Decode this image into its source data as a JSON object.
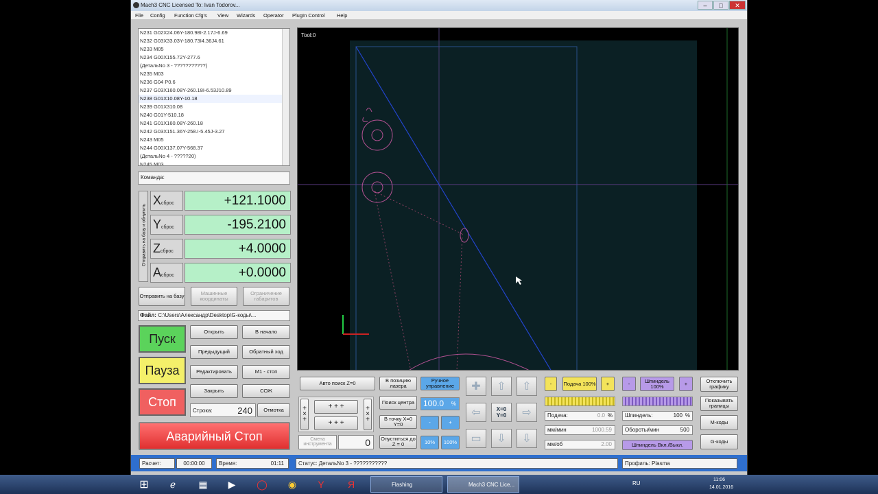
{
  "window": {
    "title": "Mach3 CNC  Licensed To: Ivan Todorov..."
  },
  "menu": [
    "File",
    "Config",
    "Function Cfg's",
    "View",
    "Wizards",
    "Operator",
    "PlugIn Control",
    "Help"
  ],
  "gcode_lines": [
    "N231 G02X24.06Y-180.98I-2.17J-6.69",
    "N232 G03X33.03Y-180.73I4.36J4.61",
    "N233 M05",
    "N234 G00X155.72Y-277.6",
    "(ДетальNo 3 - ???????????)",
    "N235 M03",
    "N236 G04 P0.6",
    "N237 G03X160.08Y-260.18I-6.53J10.89",
    "N238 G01X10.08Y-10.18",
    "N239 G01X310.08",
    "N240 G01Y-510.18",
    "N241 G01X160.08Y-260.18",
    "N242 G03X151.36Y-258.I-5.45J-3.27",
    "N243 M05",
    "N244 G00X137.07Y-568.37",
    "(ДетальNo 4 - ?????20)",
    "N245 M03"
  ],
  "selected_line": 8,
  "command_label": "Команда:",
  "dro": {
    "vertical_label": "Отправить на базу и обнулить",
    "axes": [
      {
        "letter": "X",
        "reset": "сброс",
        "value": "+121.1000"
      },
      {
        "letter": "Y",
        "reset": "сброс",
        "value": "-195.2100"
      },
      {
        "letter": "Z",
        "reset": "сброс",
        "value": "+4.0000"
      },
      {
        "letter": "A",
        "reset": "сброс",
        "value": "+0.0000"
      }
    ]
  },
  "buttons": {
    "ref_all": "Отправить на базу",
    "machine_coords": "Машинные координаты",
    "soft_limits": "Ограничение габаритов",
    "file_label": "Файл:",
    "file_path": "C:\\Users\\Александр\\Desktop\\G-коды\\..."
  },
  "run": {
    "start": "Пуск",
    "pause": "Пауза",
    "stop": "Стоп",
    "estop": "Аварийный Стоп",
    "open": "Открыть",
    "to_start": "В начало",
    "previous": "Предыдущий",
    "reverse": "Обратный ход",
    "edit": "Редактировать",
    "m1_stop": "M1 - стоп",
    "close": "Закрыть",
    "coolant": "СОЖ",
    "line_label": "Строка:",
    "line_value": "240",
    "rewind": "Отмотка"
  },
  "viewport": {
    "tool_label": "Tool:0"
  },
  "jog": {
    "auto_z": "Авто поиск Z=0",
    "laser_pos": "В позицию лазера",
    "manual": "Ручное управление",
    "find_center": "Поиск центра",
    "jog_pct": "100.0",
    "pct": "%",
    "goto_xy0": "В точку X=0 Y=0",
    "lower_z0": "Опуститься до Z = 0",
    "tool_change": "Смена инструмента",
    "tool_value": "0",
    "btn10": "10%",
    "btn100": "100%",
    "minus": "-",
    "plus": "+",
    "x0y0": "X=0 Y=0"
  },
  "feed": {
    "minus": "-",
    "plus": "+",
    "feed100": "Подача 100%",
    "feed_label": "Подача:",
    "feed_val": "0.0",
    "pct": "%",
    "mm_min_label": "мм/мин",
    "mm_min_val": "1000.59",
    "mm_rev_label": "мм/об",
    "mm_rev_val": "2.00"
  },
  "spindle": {
    "minus": "-",
    "plus": "+",
    "s100": "Шпиндель 100%",
    "label": "Шпиндель:",
    "pct_val": "100",
    "pct": "%",
    "rpm_label": "Обороты/мин",
    "rpm_val": "500",
    "toggle": "Шпиндель Вкл./Выкл."
  },
  "right_btns": [
    "Отключить графику",
    "Показывать границы",
    "М-коды",
    "G-коды"
  ],
  "status": {
    "calc_label": "Расчет:",
    "calc_val": "00:00:00",
    "time_label": "Время:",
    "time_val": "01:11",
    "status_label": "Статус:",
    "status_text": "ДетальNo 3 - ???????????",
    "profile_label": "Профиль:",
    "profile_val": "Plasma"
  },
  "taskbar": {
    "task1": "Flashing",
    "task2": "Mach3 CNC Lice...",
    "lang": "RU",
    "time": "11:06",
    "date": "14.01.2016"
  }
}
